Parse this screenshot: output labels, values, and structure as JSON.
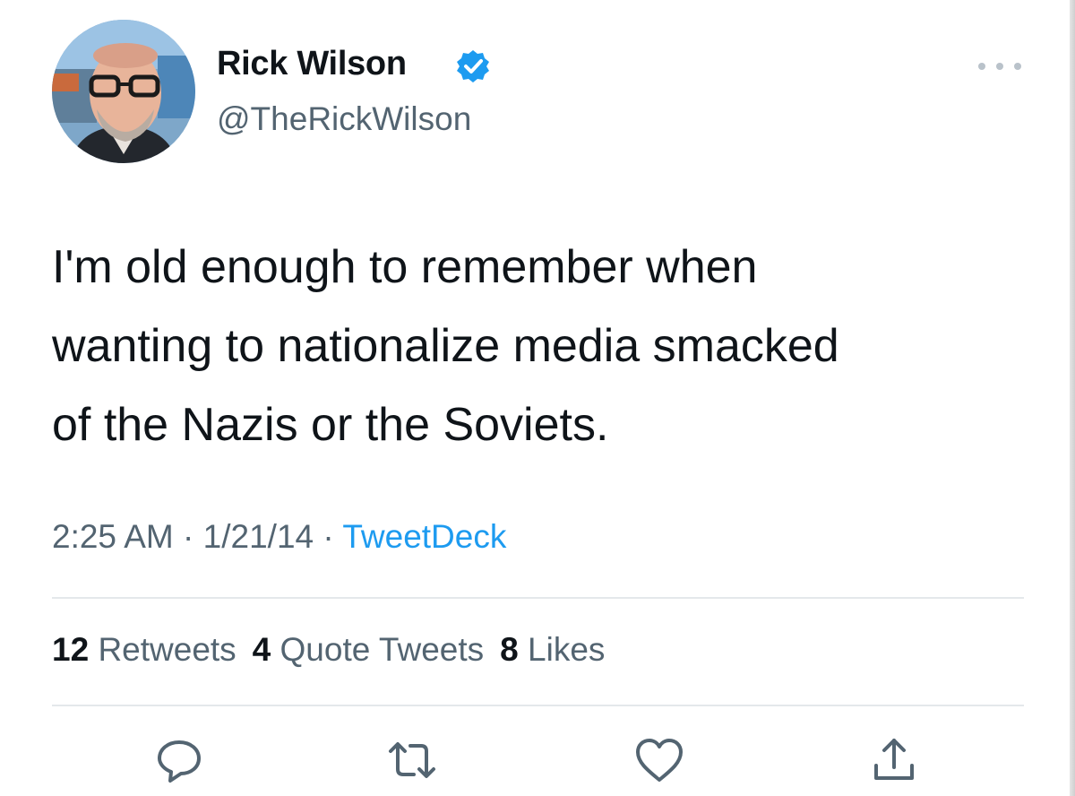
{
  "author": {
    "display_name": "Rick Wilson",
    "handle": "@TheRickWilson",
    "verified_icon": "verified-badge-icon",
    "accent": "#1d9bf0"
  },
  "tweet": {
    "line1": "I'm old enough to remember when",
    "line2": "wanting to nationalize media smacked",
    "line3": "of the Nazis or the Soviets.",
    "time": "2:25 AM",
    "date": "1/21/14",
    "separator": "·",
    "source": "TweetDeck"
  },
  "stats": {
    "retweets_count": "12",
    "retweets_label": "Retweets",
    "quotes_count": "4",
    "quotes_label": "Quote Tweets",
    "likes_count": "8",
    "likes_label": "Likes"
  },
  "actions": [
    "reply-icon",
    "retweet-icon",
    "like-icon",
    "share-icon"
  ],
  "colors": {
    "text": "#0f1419",
    "secondary": "#536471",
    "link": "#1d9bf0",
    "divider": "#e4e8eb"
  }
}
